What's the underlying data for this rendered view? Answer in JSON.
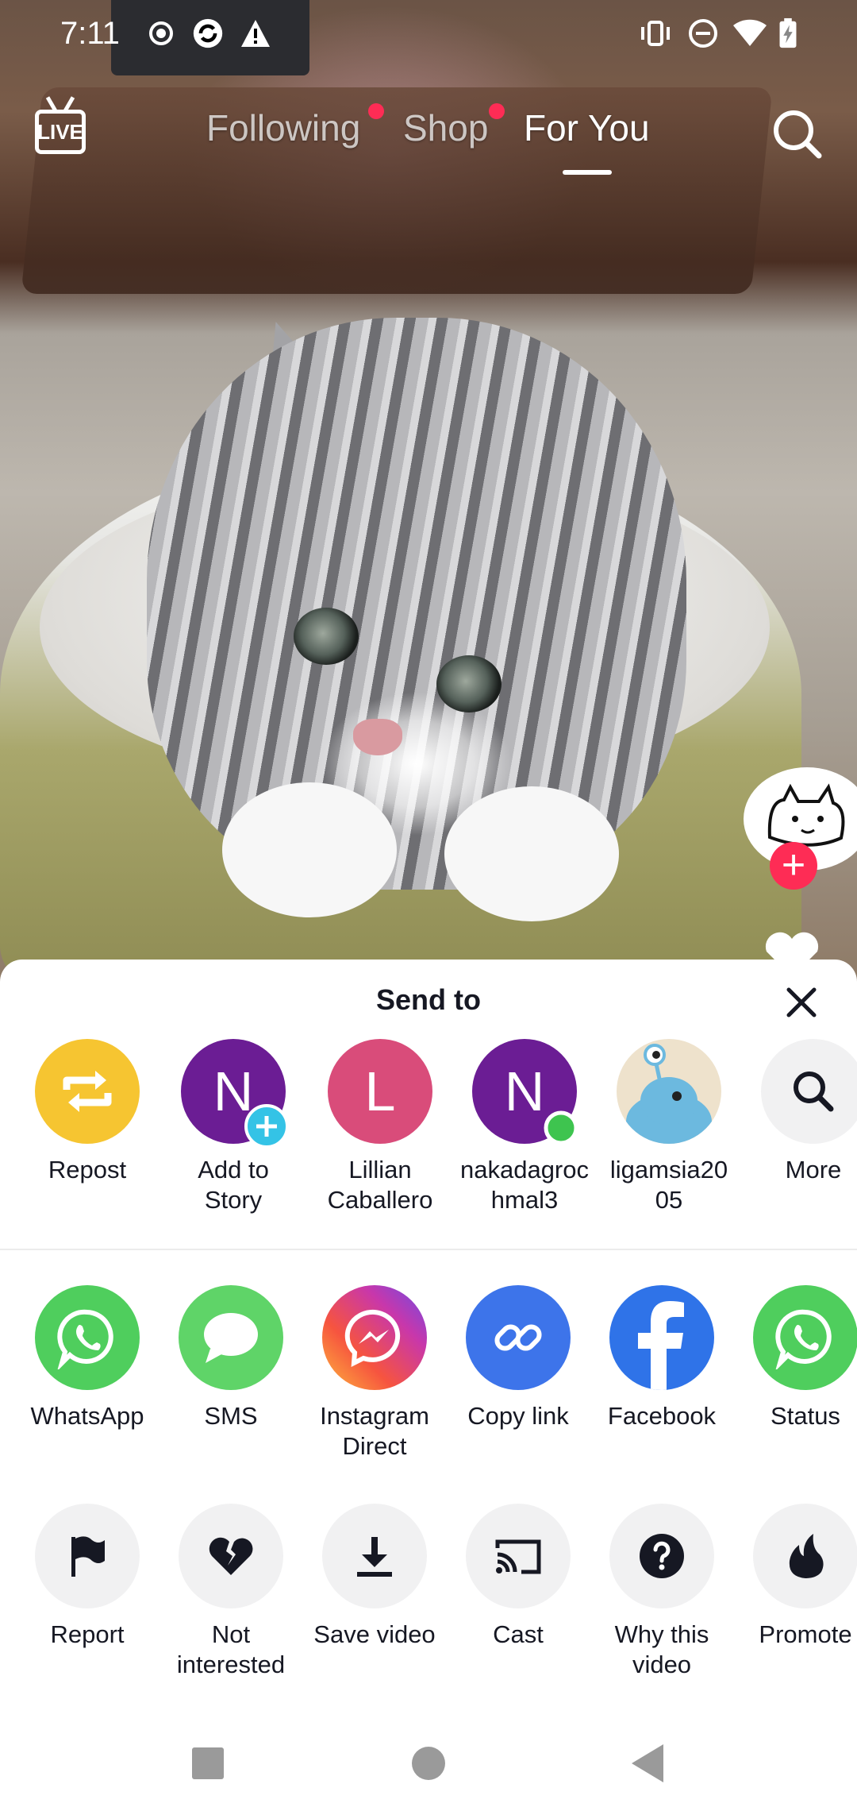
{
  "status_bar": {
    "time": "7:11",
    "icons": [
      "record-icon",
      "sync-icon",
      "warning-icon",
      "vibrate-icon",
      "do-not-disturb-icon",
      "wifi-icon",
      "battery-charging-icon"
    ]
  },
  "top_nav": {
    "live_label": "LIVE",
    "tabs": [
      {
        "label": "Following",
        "has_dot": true
      },
      {
        "label": "Shop",
        "has_dot": true
      },
      {
        "label": "For You",
        "active": true
      }
    ]
  },
  "share_sheet": {
    "title": "Send to",
    "contacts": [
      {
        "label": "Repost",
        "icon": "repost-icon",
        "color": "#f6c531"
      },
      {
        "label": "Add to\nStory",
        "letter": "N",
        "color": "#6b1d94",
        "badge": "add"
      },
      {
        "label": "Lillian\nCaballero",
        "letter": "L",
        "color": "#d94c7a"
      },
      {
        "label": "nakadagroc\nhmal3",
        "letter": "N",
        "color": "#6b1d94",
        "badge": "online"
      },
      {
        "label": "ligamsia20\n05",
        "icon": "alien-avatar-icon",
        "color": "#eee2cc"
      },
      {
        "label": "More",
        "icon": "search-icon",
        "color": "#f1f1f2"
      }
    ],
    "apps": [
      {
        "label": "WhatsApp",
        "icon": "whatsapp-icon",
        "color": "#4fce5d"
      },
      {
        "label": "SMS",
        "icon": "sms-icon",
        "color": "#5fd468"
      },
      {
        "label": "Instagram\nDirect",
        "icon": "messenger-icon",
        "color": "#c837ab"
      },
      {
        "label": "Copy link",
        "icon": "link-icon",
        "color": "#3d74ea"
      },
      {
        "label": "Facebook",
        "icon": "facebook-icon",
        "color": "#2f73e8"
      },
      {
        "label": "Status",
        "icon": "whatsapp-status-icon",
        "color": "#4fce5d"
      }
    ],
    "actions": [
      {
        "label": "Report",
        "icon": "flag-icon"
      },
      {
        "label": "Not\ninterested",
        "icon": "broken-heart-icon"
      },
      {
        "label": "Save video",
        "icon": "download-icon"
      },
      {
        "label": "Cast",
        "icon": "cast-icon"
      },
      {
        "label": "Why this\nvideo",
        "icon": "question-icon"
      },
      {
        "label": "Promote",
        "icon": "flame-icon"
      }
    ]
  },
  "nav_bar": {
    "buttons": [
      "recents-button",
      "home-button",
      "back-button"
    ]
  }
}
